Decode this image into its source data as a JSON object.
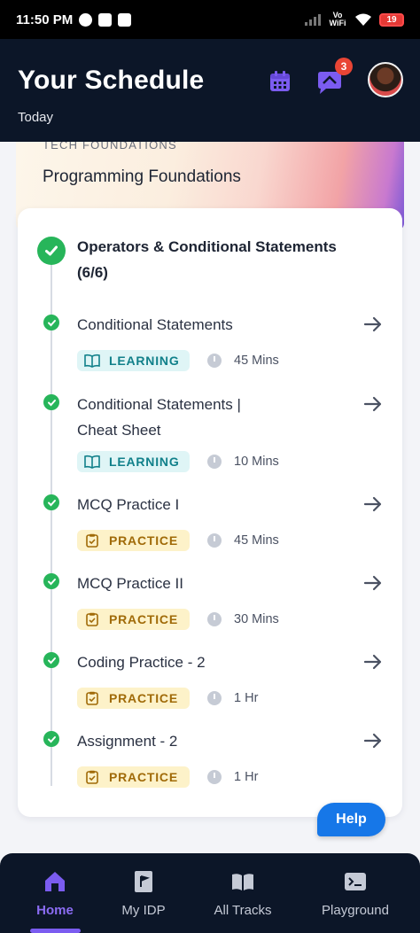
{
  "status_bar": {
    "time": "11:50 PM",
    "network_label": "Vo WiFi",
    "battery_level": "19"
  },
  "header": {
    "title": "Your Schedule",
    "subtitle": "Today",
    "notification_count": "3"
  },
  "course": {
    "eyebrow": "TECH FOUNDATIONS",
    "title": "Programming Foundations"
  },
  "module": {
    "title": "Operators & Conditional Statements (6/6)",
    "items": [
      {
        "title": "Conditional Statements",
        "tag": "LEARNING",
        "tag_type": "learning",
        "duration": "45 Mins"
      },
      {
        "title": "Conditional Statements | Cheat Sheet",
        "tag": "LEARNING",
        "tag_type": "learning",
        "duration": "10 Mins"
      },
      {
        "title": "MCQ Practice I",
        "tag": "PRACTICE",
        "tag_type": "practice",
        "duration": "45 Mins"
      },
      {
        "title": "MCQ Practice II",
        "tag": "PRACTICE",
        "tag_type": "practice",
        "duration": "30 Mins"
      },
      {
        "title": "Coding Practice - 2",
        "tag": "PRACTICE",
        "tag_type": "practice",
        "duration": "1 Hr"
      },
      {
        "title": "Assignment - 2",
        "tag": "PRACTICE",
        "tag_type": "practice",
        "duration": "1 Hr"
      }
    ]
  },
  "help_label": "Help",
  "nav": {
    "items": [
      {
        "label": "Home",
        "icon": "home-icon",
        "active": true
      },
      {
        "label": "My IDP",
        "icon": "flag-document-icon",
        "active": false
      },
      {
        "label": "All Tracks",
        "icon": "open-book-icon",
        "active": false
      },
      {
        "label": "Playground",
        "icon": "terminal-icon",
        "active": false
      }
    ]
  },
  "colors": {
    "header_bg": "#0c1628",
    "accent_purple": "#7b5cf0",
    "success_green": "#27b55a",
    "learning_tag_bg": "#dff5f6",
    "practice_tag_bg": "#fdf2c9",
    "help_blue": "#1677e8"
  }
}
